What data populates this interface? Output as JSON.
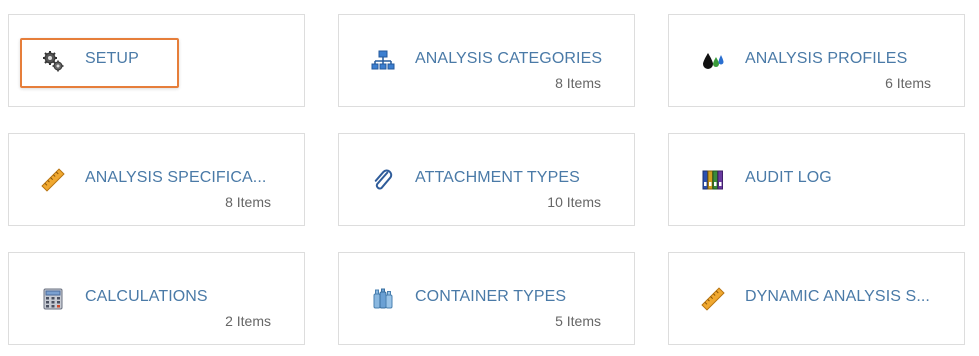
{
  "tiles": [
    {
      "title": "SETUP",
      "count": "",
      "icon": "gears-icon"
    },
    {
      "title": "ANALYSIS CATEGORIES",
      "count": "8 Items",
      "icon": "hierarchy-icon"
    },
    {
      "title": "ANALYSIS PROFILES",
      "count": "6 Items",
      "icon": "drops-icon"
    },
    {
      "title": "ANALYSIS SPECIFICA...",
      "count": "8 Items",
      "icon": "ruler-icon"
    },
    {
      "title": "ATTACHMENT TYPES",
      "count": "10 Items",
      "icon": "paperclip-icon"
    },
    {
      "title": "AUDIT LOG",
      "count": "",
      "icon": "binders-icon"
    },
    {
      "title": "CALCULATIONS",
      "count": "2 Items",
      "icon": "calculator-icon"
    },
    {
      "title": "CONTAINER TYPES",
      "count": "5 Items",
      "icon": "bottles-icon"
    },
    {
      "title": "DYNAMIC ANALYSIS S...",
      "count": "",
      "icon": "ruler-icon"
    }
  ],
  "colors": {
    "title": "#4a7aa7",
    "count": "#666666",
    "border": "#dddddd",
    "highlight": "#e67e3a"
  }
}
